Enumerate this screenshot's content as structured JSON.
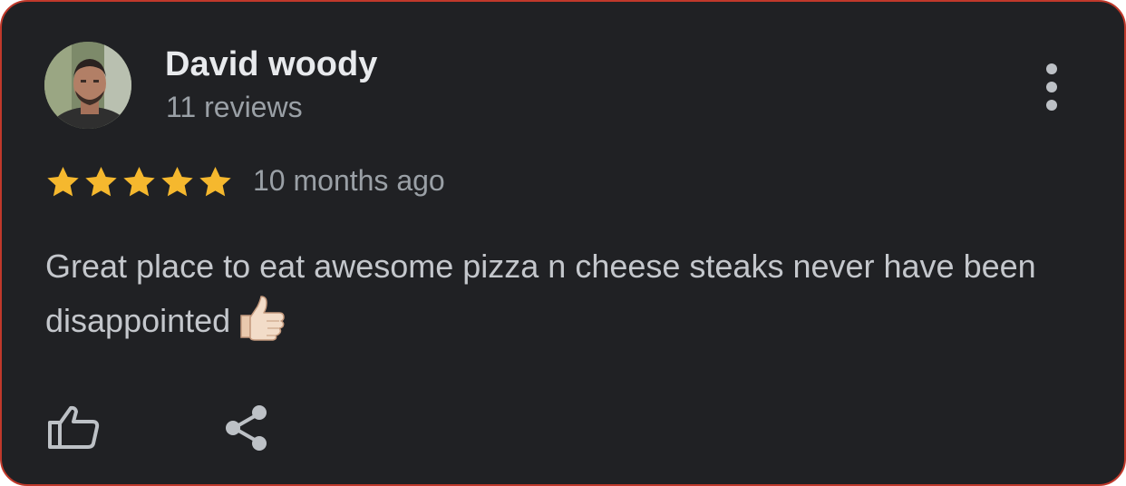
{
  "review": {
    "author_name": "David woody",
    "review_count": "11 reviews",
    "rating": 5,
    "rating_max": 5,
    "time_ago": "10 months ago",
    "text": "Great place to eat awesome pizza n cheese steaks never have been disappointed",
    "emoji": "thumbs-up-emoji"
  },
  "icons": {
    "more": "more-vert-icon",
    "like": "thumb-up-outline-icon",
    "share": "share-icon"
  },
  "colors": {
    "card_background": "#202124",
    "card_border": "#c0392b",
    "star": "#f5b82e",
    "primary_text": "#e8eaed",
    "secondary_text": "#9aa0a6"
  }
}
